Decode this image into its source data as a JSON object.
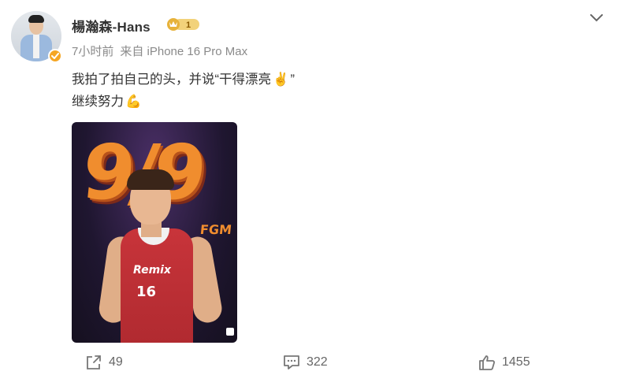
{
  "post": {
    "username": "楊瀚森-Hans",
    "vip_level": "1",
    "time": "7小时前",
    "source": "来自 iPhone 16 Pro Max",
    "text_line1": "我拍了拍自己的头，并说“干得漂亮",
    "text_line1_end": "”",
    "text_line2": "继续努力",
    "emoji_line1": "✌️",
    "emoji_line2": "💪",
    "image": {
      "stat": "9/9",
      "stat_label": "FGM",
      "team": "Remix",
      "jersey_number": "16"
    }
  },
  "actions": {
    "share_count": "49",
    "comment_count": "322",
    "like_count": "1455"
  },
  "icons": {
    "verified": "verified-badge-icon",
    "expand": "chevron-down-icon",
    "share": "share-icon",
    "comment": "comment-icon",
    "like": "thumbs-up-icon"
  },
  "colors": {
    "accent": "#f5a623",
    "text": "#333333",
    "meta": "#8a8a8a"
  }
}
